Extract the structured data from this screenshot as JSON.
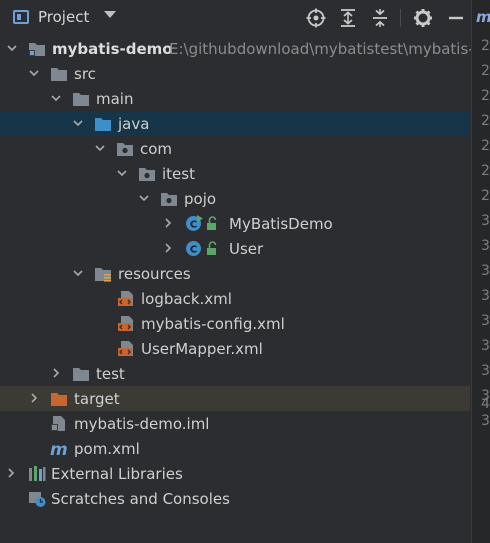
{
  "header": {
    "title": "Project",
    "icons": [
      "locate-icon",
      "expand-all-icon",
      "collapse-all-icon",
      "gear-icon",
      "hide-icon"
    ]
  },
  "tree": {
    "root": {
      "label": "mybatis-demo",
      "path": "E:\\githubdownload\\mybatistest\\mybatis-d"
    },
    "src": "src",
    "main": "main",
    "java": "java",
    "com": "com",
    "itest": "itest",
    "pojo": "pojo",
    "class_mybatisdemo": "MyBatisDemo",
    "class_user": "User",
    "resources": "resources",
    "logback": "logback.xml",
    "mybatis_config": "mybatis-config.xml",
    "usermapper": "UserMapper.xml",
    "test": "test",
    "target": "target",
    "iml": "mybatis-demo.iml",
    "pom": "pom.xml",
    "external_libraries": "External Libraries",
    "scratches": "Scratches and Consoles"
  },
  "editor_gutter": {
    "tab_glyph": "m",
    "line_numbers": [
      "2",
      "2",
      "2",
      "2",
      "2",
      "2",
      "2",
      "3",
      "3",
      "3",
      "3",
      "3",
      "3",
      "3",
      "3",
      "3",
      "4"
    ]
  },
  "colors": {
    "background": "#2b2d30",
    "selected_row": "#163549",
    "excluded_row": "#3c3a35",
    "folder": "#7f8790",
    "source_folder": "#3d8ec9",
    "excluded_folder": "#c7672f"
  }
}
